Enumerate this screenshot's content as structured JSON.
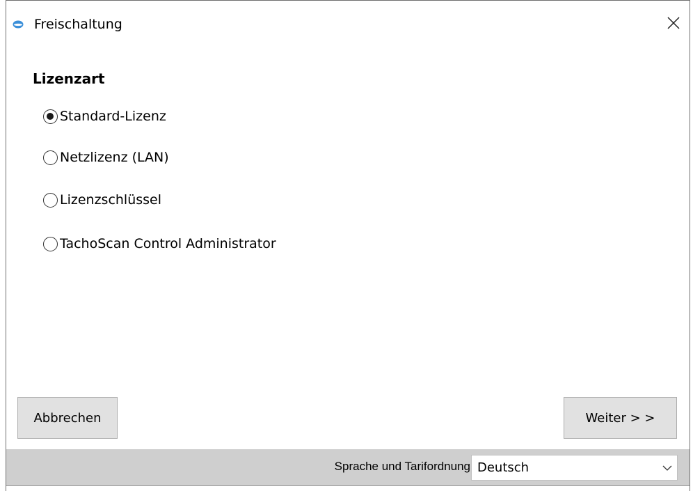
{
  "window": {
    "title": "Freischaltung",
    "app_icon": "app-logo-icon",
    "close_icon": "close-icon"
  },
  "license": {
    "heading": "Lizenzart",
    "options": [
      {
        "label": "Standard-Lizenz",
        "selected": true
      },
      {
        "label": "Netzlizenz (LAN)",
        "selected": false
      },
      {
        "label": "Lizenzschlüssel",
        "selected": false
      },
      {
        "label": "TachoScan Control Administrator",
        "selected": false
      }
    ]
  },
  "buttons": {
    "cancel_label": "Abbrechen",
    "next_label": "Weiter > >"
  },
  "footer": {
    "language_label": "Sprache und Tarifordnung",
    "language_value": "Deutsch",
    "dropdown_icon": "chevron-down-icon"
  },
  "colors": {
    "footer_bg": "#cfcfcf",
    "button_bg": "#e1e1e1",
    "app_icon_blue": "#3b8fd9"
  }
}
